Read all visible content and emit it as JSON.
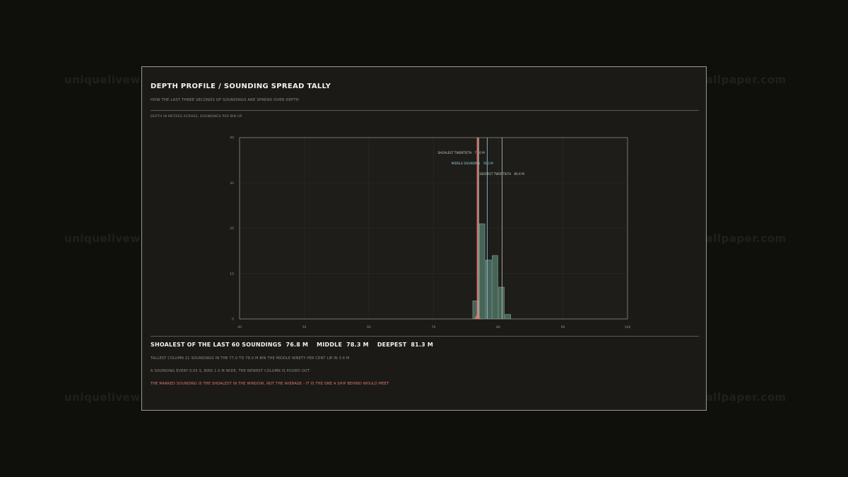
{
  "watermark": "uniquelivewallpaper.com",
  "panel": {
    "title": "DEPTH PROFILE / SOUNDING SPREAD TALLY",
    "subtitle": "HOW THE LAST THREE SECONDS OF SOUNDINGS ARE SPREAD OVER DEPTH",
    "axis_note": "DEPTH IN METRES ACROSS, SOUNDINGS PER BIN UP"
  },
  "summary": {
    "shoalest_label": "SHOALEST OF THE LAST 60 SOUNDINGS",
    "shoalest_value": "76.8 M",
    "middle_label": "MIDDLE",
    "middle_value": "78.3 M",
    "deepest_label": "DEEPEST",
    "deepest_value": "81.3 M"
  },
  "notes": {
    "tallest": "TALLEST COLUMN 21 SOUNDINGS IN THE 77.0 TO 78.0 M BIN   THE MIDDLE NINETY PER CENT LIE IN  3.6 M",
    "cadence": "A SOUNDING EVERY 0.05 S, BINS 1.0 M WIDE, THE NEWEST COLUMN IS PICKED OUT",
    "warning": "THE MARKED SOUNDING IS THE SHOALEST IN THE WINDOW, NOT THE AVERAGE - IT IS THE ONE A SHIP BEHIND WOULD MEET"
  },
  "colors": {
    "bar": "#4a6b5e",
    "bar_edge": "#9fc7b5",
    "marker": "#e07a70",
    "middle_line": "#8fcfe0",
    "twentieth_line": "#b9c7c0",
    "grid": "#2c2c27",
    "frame": "#8a8a82"
  },
  "chart_data": {
    "type": "bar",
    "xlabel": "DEPTH IN METRES ACROSS",
    "ylabel": "SOUNDINGS PER BIN UP",
    "xlim": [
      40,
      100
    ],
    "ylim": [
      0,
      40
    ],
    "xticks": [
      40,
      50,
      60,
      70,
      80,
      90,
      100
    ],
    "yticks": [
      0,
      10,
      20,
      30,
      40
    ],
    "grid": true,
    "bin_width": 1.0,
    "bins": [
      {
        "start": 76,
        "count": 4
      },
      {
        "start": 77,
        "count": 21
      },
      {
        "start": 78,
        "count": 13
      },
      {
        "start": 79,
        "count": 14
      },
      {
        "start": 80,
        "count": 7
      },
      {
        "start": 81,
        "count": 1
      }
    ],
    "marker": {
      "value": 76.8
    },
    "lines": [
      {
        "label": "SHOALEST TWENTIETH",
        "value": 77.0,
        "value_text": "77.0 M",
        "role": "twentieth"
      },
      {
        "label": "MIDDLE SOUNDING",
        "value": 78.3,
        "value_text": "78.3 M",
        "role": "middle"
      },
      {
        "label": "DEEPEST TWENTIETH",
        "value": 80.6,
        "value_text": "80.6 M",
        "role": "twentieth"
      }
    ]
  }
}
